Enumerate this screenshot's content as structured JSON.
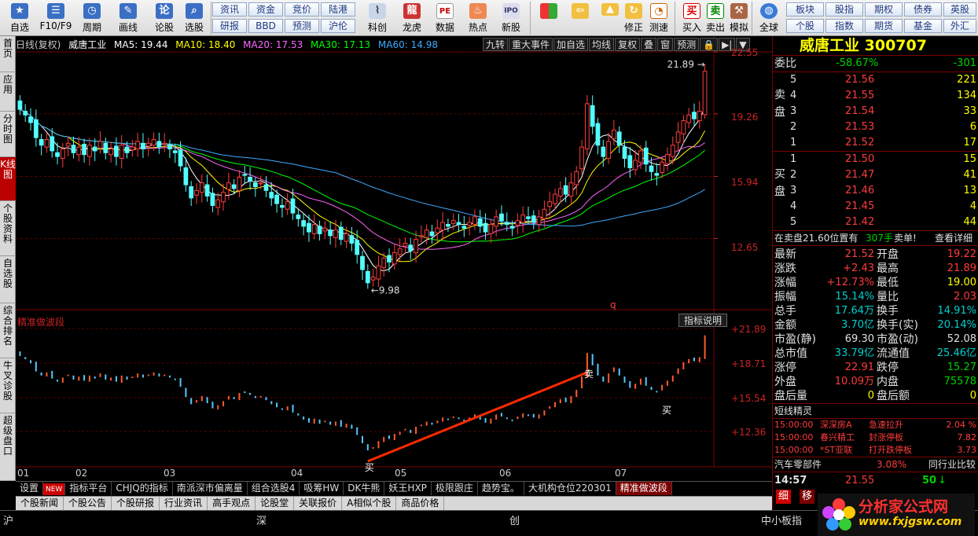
{
  "toolbar": {
    "buttons": [
      {
        "label": "自选",
        "icon": "star-icon"
      },
      {
        "label": "F10/F9",
        "icon": "list-icon"
      },
      {
        "label": "周期",
        "icon": "clock-icon"
      },
      {
        "label": "画线",
        "icon": "pencil-icon"
      },
      {
        "label": "论股",
        "icon": "chat-icon"
      },
      {
        "label": "选股",
        "icon": "chart-search-icon"
      }
    ],
    "small_buttons_row1": [
      "资讯",
      "资金",
      "竞价",
      "陆港"
    ],
    "small_buttons_row2": [
      "研报",
      "BBD",
      "预测",
      "沪伦"
    ],
    "buttons2": [
      {
        "label": "科创",
        "icon": "science-icon"
      },
      {
        "label": "龙虎",
        "icon": "dragon-icon"
      },
      {
        "label": "数据",
        "icon": "pe-icon"
      },
      {
        "label": "热点",
        "icon": "fire-icon"
      },
      {
        "label": "新股",
        "icon": "ipo-icon"
      }
    ],
    "buttons3": [
      {
        "label": "",
        "icon": "windows-icon"
      },
      {
        "label": "",
        "icon": "back-arrow-icon"
      },
      {
        "label": "修正",
        "icon": "refresh-icon"
      },
      {
        "label": "测速",
        "icon": "timer-icon"
      },
      {
        "label": "买入",
        "icon": "buy-icon"
      },
      {
        "label": "卖出",
        "icon": "sell-icon"
      },
      {
        "label": "模拟",
        "icon": "hammer-icon"
      },
      {
        "label": "全球",
        "icon": "globe-icon"
      }
    ],
    "small_buttons_row3": [
      "板块",
      "股指",
      "期权",
      "债券",
      "英股"
    ],
    "small_buttons_row4": [
      "个股",
      "指数",
      "期货",
      "基金",
      "外汇"
    ]
  },
  "left_tabs": [
    "首页",
    "应用",
    "分时图",
    "K线图",
    "个股资料",
    "自选股",
    "综合排名",
    "牛叉诊股",
    "超级盘口"
  ],
  "chart": {
    "period_label": "日线(复权)",
    "stock_name": "威唐工业",
    "ma": [
      {
        "label": "MA5: 19.44",
        "color": "#ffffff"
      },
      {
        "label": "MA10: 18.40",
        "color": "#ffff00"
      },
      {
        "label": "MA20: 17.53",
        "color": "#ff66ff"
      },
      {
        "label": "MA30: 17.13",
        "color": "#00ff00"
      },
      {
        "label": "MA60: 14.98",
        "color": "#3fa9ff"
      }
    ],
    "buttons": [
      "九转",
      "重大事件",
      "加自选",
      "均线",
      "复权",
      "叠",
      "窗",
      "预测",
      "🔒",
      "▶|",
      "▼"
    ],
    "y_ticks": [
      "22.55",
      "19.26",
      "15.94",
      "12.65"
    ],
    "high_label": "21.89",
    "low_label": "9.98",
    "marker_q": "q",
    "indicator_title": "精准做波段",
    "indicator_help": "指标说明",
    "ind_y_ticks": [
      "+21.89",
      "+18.71",
      "+15.54",
      "+12.36"
    ],
    "buy_label": "买",
    "sell_label": "卖",
    "months": [
      "01",
      "02",
      "03",
      "04",
      "05",
      "06",
      "07"
    ]
  },
  "chart_data": {
    "type": "candlestick",
    "title": "威唐工业 日线(复权)",
    "x": [
      "01",
      "02",
      "03",
      "04",
      "05",
      "06",
      "07"
    ],
    "ylim": [
      9.98,
      22.55
    ],
    "high": 21.89,
    "low": 9.98,
    "series": [
      {
        "name": "MA5",
        "last": 19.44
      },
      {
        "name": "MA10",
        "last": 18.4
      },
      {
        "name": "MA20",
        "last": 17.53
      },
      {
        "name": "MA30",
        "last": 17.13
      },
      {
        "name": "MA60",
        "last": 14.98
      }
    ],
    "closes": [
      19.5,
      19.2,
      18.8,
      18.0,
      17.6,
      17.9,
      17.3,
      17.0,
      17.4,
      17.7,
      17.2,
      17.5,
      17.1,
      17.6,
      17.3,
      17.8,
      17.2,
      17.4,
      17.0,
      17.6,
      17.2,
      17.5,
      17.8,
      17.4,
      17.7,
      17.9,
      17.5,
      17.7,
      17.4,
      17.2,
      16.5,
      15.5,
      14.8,
      15.2,
      15.6,
      14.9,
      14.4,
      14.7,
      15.1,
      15.6,
      15.3,
      15.9,
      16.0,
      15.7,
      15.4,
      15.6,
      15.2,
      14.8,
      14.5,
      14.3,
      14.6,
      14.0,
      13.7,
      13.3,
      13.0,
      13.4,
      12.9,
      13.2,
      12.8,
      13.1,
      12.6,
      12.9,
      12.4,
      11.8,
      11.0,
      10.3,
      10.6,
      11.2,
      11.6,
      11.4,
      11.9,
      12.1,
      12.4,
      12.0,
      12.6,
      12.8,
      13.1,
      12.8,
      13.2,
      13.5,
      13.3,
      13.6,
      13.4,
      13.2,
      13.5,
      13.8,
      13.3,
      13.0,
      13.4,
      13.8,
      13.6,
      13.4,
      13.2,
      13.6,
      13.9,
      13.7,
      13.5,
      13.8,
      14.2,
      14.6,
      15.0,
      15.3,
      15.0,
      15.6,
      16.2,
      17.5,
      19.8,
      18.6,
      17.6,
      17.0,
      17.8,
      18.4,
      17.6,
      16.9,
      16.4,
      16.8,
      17.3,
      16.6,
      16.2,
      16.0,
      16.7,
      17.1,
      17.6,
      18.3,
      18.9,
      19.2,
      19.0,
      19.4,
      21.52
    ]
  },
  "quote": {
    "name": "威唐工业",
    "code": "300707",
    "weibi_label": "委比",
    "weibi_pct": "-58.67%",
    "weibi_val": "-301",
    "sell_label": "卖盘",
    "buy_label": "买盘",
    "asks": [
      {
        "lvl": "5",
        "price": "21.56",
        "vol": "221"
      },
      {
        "lvl": "4",
        "price": "21.55",
        "vol": "134"
      },
      {
        "lvl": "3",
        "price": "21.54",
        "vol": "33"
      },
      {
        "lvl": "2",
        "price": "21.53",
        "vol": "6"
      },
      {
        "lvl": "1",
        "price": "21.52",
        "vol": "17"
      }
    ],
    "bids": [
      {
        "lvl": "1",
        "price": "21.50",
        "vol": "15"
      },
      {
        "lvl": "2",
        "price": "21.47",
        "vol": "41"
      },
      {
        "lvl": "3",
        "price": "21.46",
        "vol": "13"
      },
      {
        "lvl": "4",
        "price": "21.45",
        "vol": "4"
      },
      {
        "lvl": "5",
        "price": "21.42",
        "vol": "44"
      }
    ],
    "notice_text": "在卖盘21.60位置有",
    "notice_vol": "307手",
    "notice_action": "卖单!",
    "notice_link": "查看详细",
    "stats": [
      {
        "l1": "最新",
        "v1": "21.52",
        "c1": "red",
        "l2": "开盘",
        "v2": "19.22",
        "c2": "red"
      },
      {
        "l1": "涨跌",
        "v1": "+2.43",
        "c1": "red",
        "l2": "最高",
        "v2": "21.89",
        "c2": "red"
      },
      {
        "l1": "涨幅",
        "v1": "+12.73%",
        "c1": "red",
        "l2": "最低",
        "v2": "19.00",
        "c2": "yellow"
      },
      {
        "l1": "振幅",
        "v1": "15.14%",
        "c1": "cyan",
        "l2": "量比",
        "v2": "2.03",
        "c2": "red"
      },
      {
        "l1": "总手",
        "v1": "17.64万",
        "c1": "cyan",
        "l2": "换手",
        "v2": "14.91%",
        "c2": "cyan"
      },
      {
        "l1": "金额",
        "v1": "3.70亿",
        "c1": "cyan",
        "l2": "换手(实)",
        "v2": "20.14%",
        "c2": "cyan"
      },
      {
        "l1": "市盈(静)",
        "v1": "69.30",
        "c1": "white",
        "l2": "市盈(动)",
        "v2": "52.08",
        "c2": "white"
      },
      {
        "l1": "总市值",
        "v1": "33.79亿",
        "c1": "cyan",
        "l2": "流通值",
        "v2": "25.46亿",
        "c2": "cyan"
      },
      {
        "l1": "涨停",
        "v1": "22.91",
        "c1": "red",
        "l2": "跌停",
        "v2": "15.27",
        "c2": "green"
      },
      {
        "l1": "外盘",
        "v1": "10.09万",
        "c1": "red",
        "l2": "内盘",
        "v2": "75578",
        "c2": "green"
      },
      {
        "l1": "盘后量",
        "v1": "0",
        "c1": "yellow",
        "l2": "盘后额",
        "v2": "0",
        "c2": "yellow"
      }
    ],
    "elf_title": "短线精灵",
    "elf_rows": [
      {
        "time": "15:00:00",
        "name": "深深房A",
        "event": "急速拉升",
        "val": "2.04 %"
      },
      {
        "time": "15:00:00",
        "name": "春兴精工",
        "event": "封涨停板",
        "val": "7.82"
      },
      {
        "time": "15:00:00",
        "name": "*ST亚联",
        "event": "打开跌停板",
        "val": "3.73"
      }
    ],
    "sector": "汽车零部件",
    "sector_pct": "3.08%",
    "sector_compare": "同行业比较",
    "last_time": "14:57",
    "last_price": "21.55",
    "last_vol": "50",
    "detail_tab": "细",
    "rank_tab": "移"
  },
  "tabs1": [
    "设置",
    "NEW",
    "指标平台",
    "CHJQ的指标",
    "南派深市偏离量",
    "组合选股4",
    "吸筹HW",
    "DK牛熊",
    "妖王HXP",
    "极限跟庄",
    "趋势宝。",
    "大机构仓位220301",
    "精准做波段"
  ],
  "tabs2": [
    "个股新闻",
    "个股公告",
    "个股研报",
    "行业资讯",
    "高手观点",
    "论股堂",
    "关联报价",
    "A相似个股",
    "商品价格"
  ],
  "status": {
    "sh": "沪",
    "sz": "深",
    "cy": "创",
    "zxb": "中小板指"
  },
  "logo": {
    "name": "分析家公式网",
    "url": "www.fxjgsw.com"
  }
}
